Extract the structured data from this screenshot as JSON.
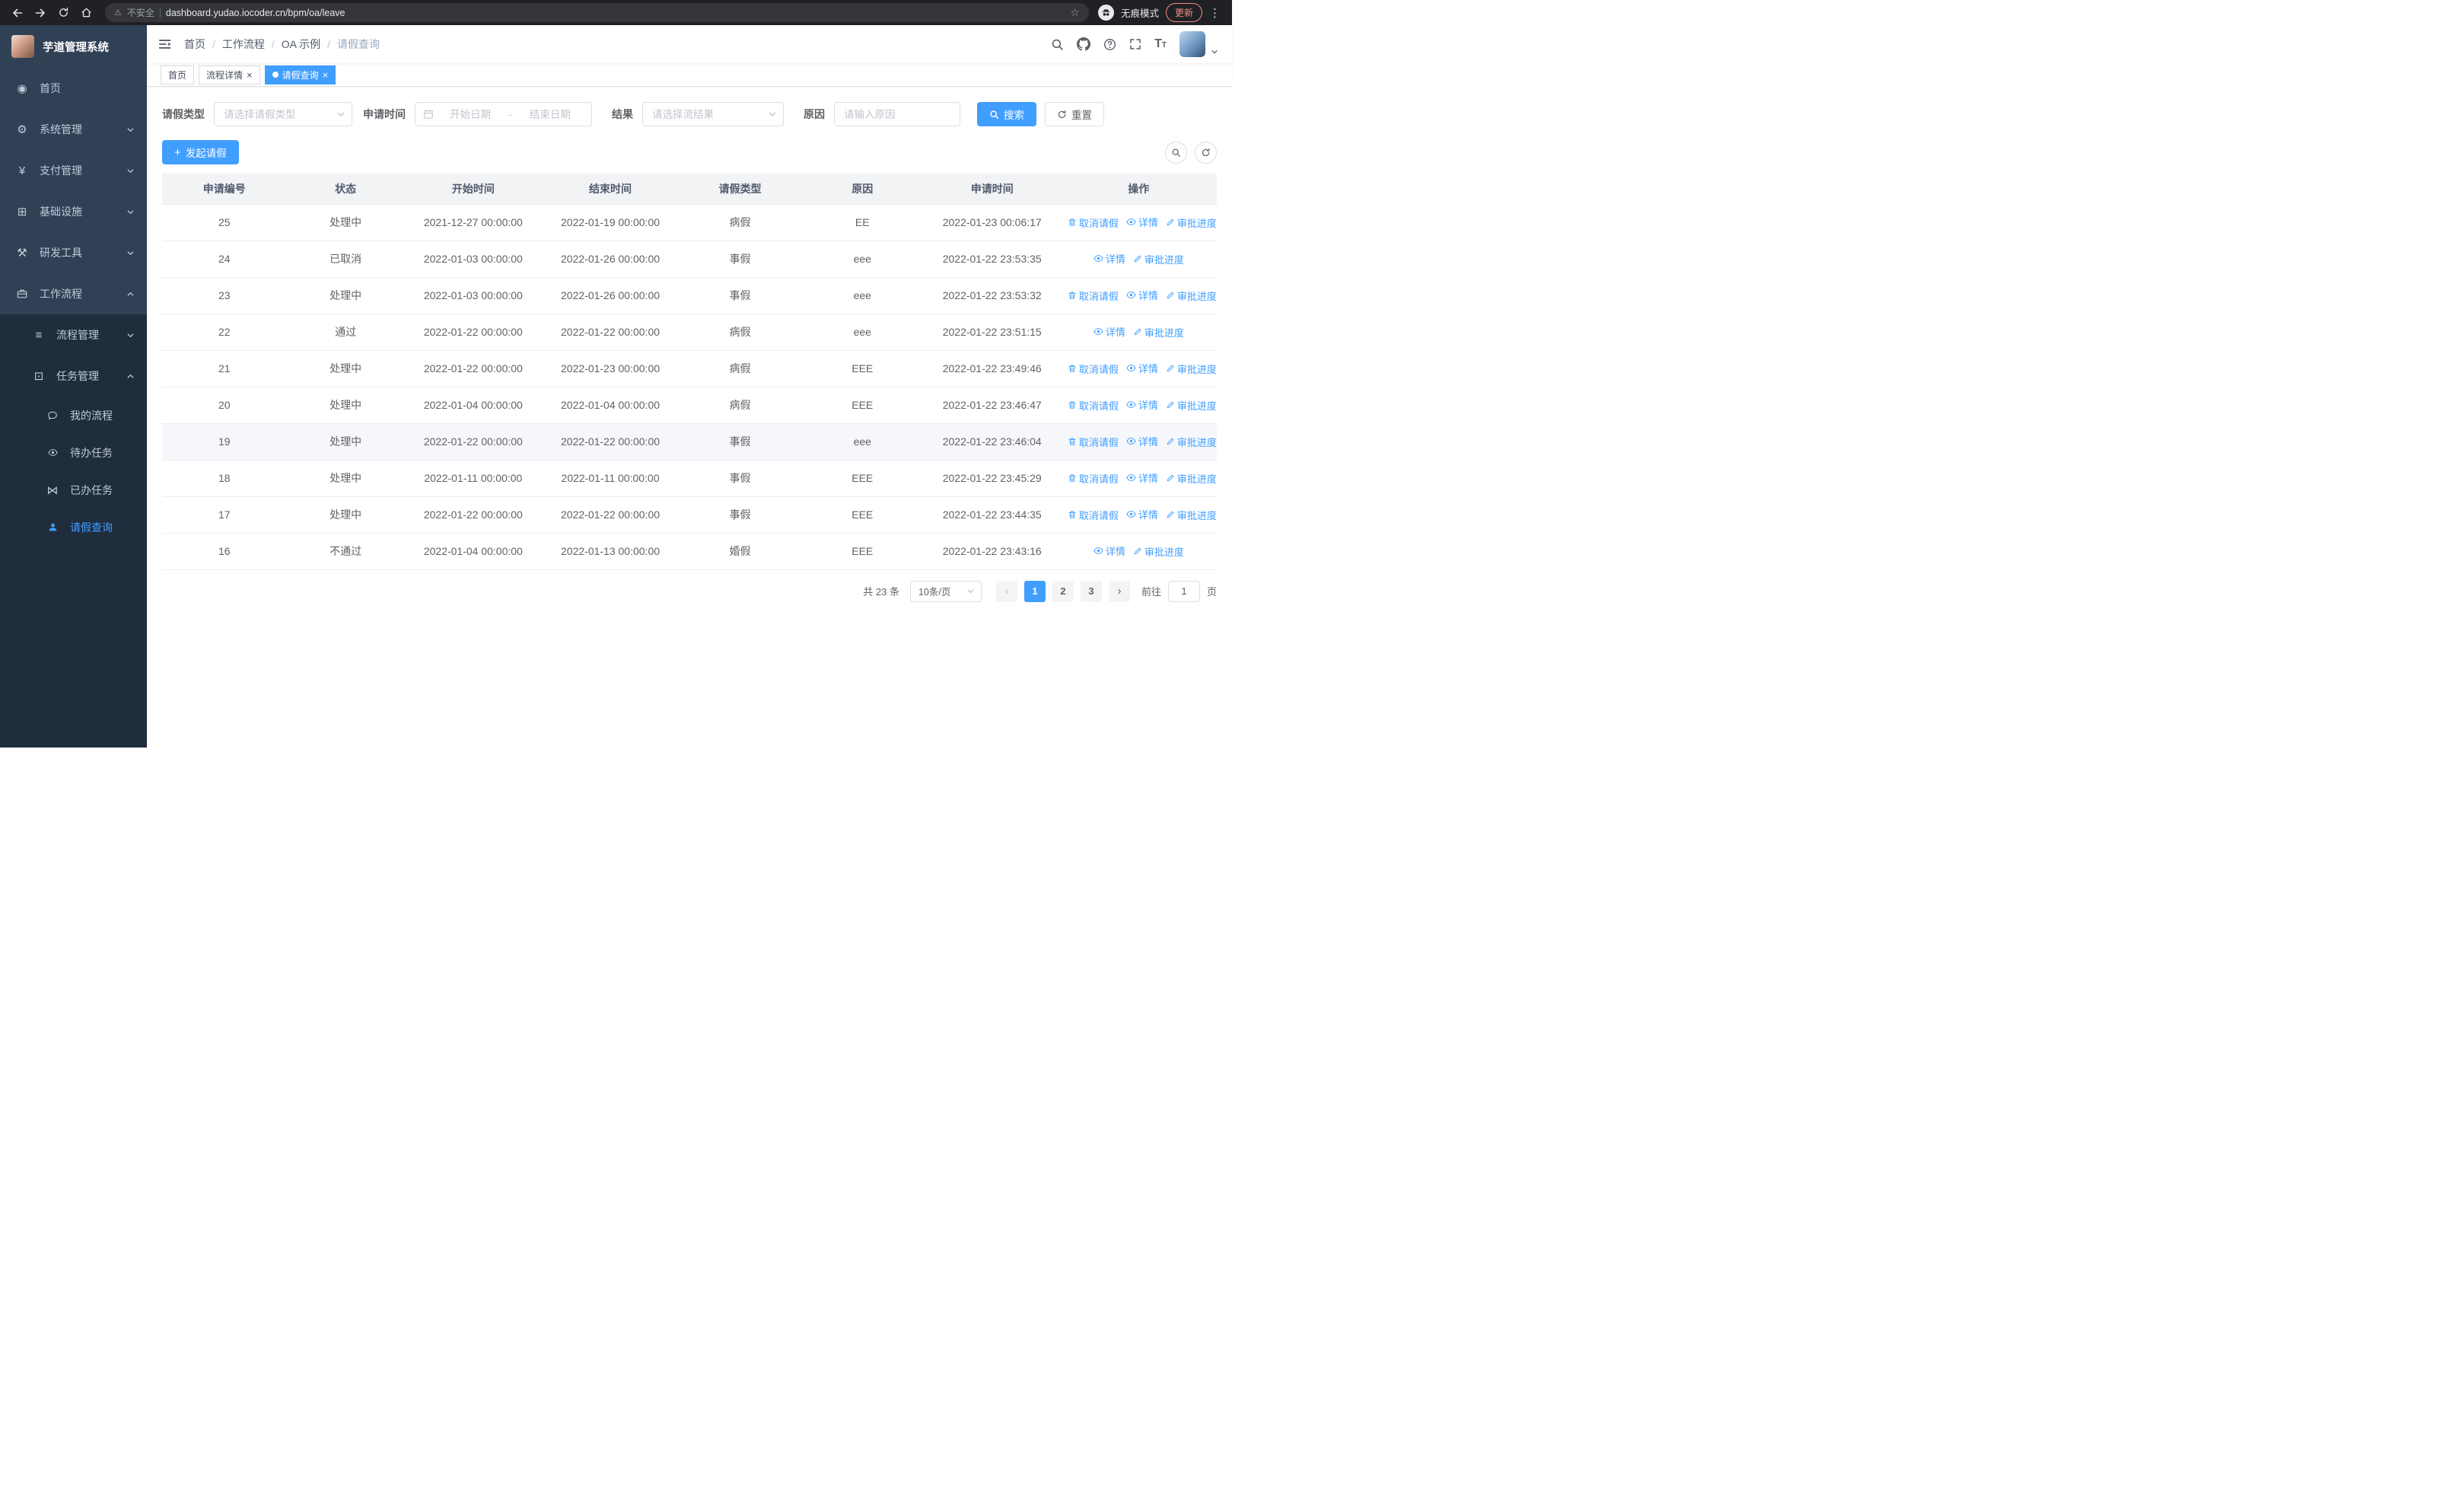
{
  "browser": {
    "security_label": "不安全",
    "url": "dashboard.yudao.iocoder.cn/bpm/oa/leave",
    "incognito_label": "无痕模式",
    "update_label": "更新"
  },
  "sidebar": {
    "title": "芋道管理系统",
    "items": [
      {
        "key": "home",
        "label": "首页",
        "icon": "dashboard-icon",
        "level": 1
      },
      {
        "key": "system",
        "label": "系统管理",
        "icon": "gear-icon",
        "level": 1,
        "chevron": "down"
      },
      {
        "key": "payment",
        "label": "支付管理",
        "icon": "yen-icon",
        "level": 1,
        "chevron": "down"
      },
      {
        "key": "infra",
        "label": "基础设施",
        "icon": "monitor-icon",
        "level": 1,
        "chevron": "down"
      },
      {
        "key": "devtools",
        "label": "研发工具",
        "icon": "tools-icon",
        "level": 1,
        "chevron": "down"
      },
      {
        "key": "workflow",
        "label": "工作流程",
        "icon": "briefcase-icon",
        "level": 1,
        "chevron": "up",
        "expanded": true
      },
      {
        "key": "process-mgmt",
        "label": "流程管理",
        "icon": "list-icon",
        "level": 2,
        "chevron": "down"
      },
      {
        "key": "task-mgmt",
        "label": "任务管理",
        "icon": "tasks-icon",
        "level": 2,
        "chevron": "up",
        "expanded": true
      },
      {
        "key": "my-process",
        "label": "我的流程",
        "icon": "message-icon",
        "level": 3
      },
      {
        "key": "todo-task",
        "label": "待办任务",
        "icon": "eye-icon",
        "level": 3
      },
      {
        "key": "done-task",
        "label": "已办任务",
        "icon": "done-icon",
        "level": 3
      },
      {
        "key": "leave-query",
        "label": "请假查询",
        "icon": "user-icon",
        "level": 3,
        "active": true
      }
    ]
  },
  "header": {
    "breadcrumb": [
      "首页",
      "工作流程",
      "OA 示例",
      "请假查询"
    ]
  },
  "tabs": [
    {
      "key": "home",
      "label": "首页",
      "active": false,
      "closable": false
    },
    {
      "key": "process-detail",
      "label": "流程详情",
      "active": false,
      "closable": true
    },
    {
      "key": "leave-query",
      "label": "请假查询",
      "active": true,
      "closable": true
    }
  ],
  "filters": {
    "leave_type_label": "请假类型",
    "leave_type_placeholder": "请选择请假类型",
    "apply_time_label": "申请时间",
    "start_date_placeholder": "开始日期",
    "range_separator": "-",
    "end_date_placeholder": "结束日期",
    "result_label": "结果",
    "result_placeholder": "请选择流结果",
    "reason_label": "原因",
    "reason_placeholder": "请输入原因",
    "search_label": "搜索",
    "reset_label": "重置"
  },
  "toolbar": {
    "create_label": "发起请假"
  },
  "table": {
    "columns": [
      "申请编号",
      "状态",
      "开始时间",
      "结束时间",
      "请假类型",
      "原因",
      "申请时间",
      "操作"
    ],
    "column_keys": [
      "application-id",
      "status",
      "start-time",
      "end-time",
      "leave-type",
      "reason",
      "apply-time",
      "operations"
    ],
    "ops_labels": {
      "cancel": "取消请假",
      "detail": "详情",
      "progress": "审批进度"
    },
    "rows": [
      {
        "id": "25",
        "status": "处理中",
        "start": "2021-12-27 00:00:00",
        "end": "2022-01-19 00:00:00",
        "type": "病假",
        "reason": "EE",
        "applied": "2022-01-23 00:06:17",
        "ops": [
          "cancel",
          "detail",
          "progress"
        ],
        "highlight": false
      },
      {
        "id": "24",
        "status": "已取消",
        "start": "2022-01-03 00:00:00",
        "end": "2022-01-26 00:00:00",
        "type": "事假",
        "reason": "eee",
        "applied": "2022-01-22 23:53:35",
        "ops": [
          "detail",
          "progress"
        ],
        "highlight": false
      },
      {
        "id": "23",
        "status": "处理中",
        "start": "2022-01-03 00:00:00",
        "end": "2022-01-26 00:00:00",
        "type": "事假",
        "reason": "eee",
        "applied": "2022-01-22 23:53:32",
        "ops": [
          "cancel",
          "detail",
          "progress"
        ],
        "highlight": false
      },
      {
        "id": "22",
        "status": "通过",
        "start": "2022-01-22 00:00:00",
        "end": "2022-01-22 00:00:00",
        "type": "病假",
        "reason": "eee",
        "applied": "2022-01-22 23:51:15",
        "ops": [
          "detail",
          "progress"
        ],
        "highlight": false
      },
      {
        "id": "21",
        "status": "处理中",
        "start": "2022-01-22 00:00:00",
        "end": "2022-01-23 00:00:00",
        "type": "病假",
        "reason": "EEE",
        "applied": "2022-01-22 23:49:46",
        "ops": [
          "cancel",
          "detail",
          "progress"
        ],
        "highlight": false
      },
      {
        "id": "20",
        "status": "处理中",
        "start": "2022-01-04 00:00:00",
        "end": "2022-01-04 00:00:00",
        "type": "病假",
        "reason": "EEE",
        "applied": "2022-01-22 23:46:47",
        "ops": [
          "cancel",
          "detail",
          "progress"
        ],
        "highlight": false
      },
      {
        "id": "19",
        "status": "处理中",
        "start": "2022-01-22 00:00:00",
        "end": "2022-01-22 00:00:00",
        "type": "事假",
        "reason": "eee",
        "applied": "2022-01-22 23:46:04",
        "ops": [
          "cancel",
          "detail",
          "progress"
        ],
        "highlight": true
      },
      {
        "id": "18",
        "status": "处理中",
        "start": "2022-01-11 00:00:00",
        "end": "2022-01-11 00:00:00",
        "type": "事假",
        "reason": "EEE",
        "applied": "2022-01-22 23:45:29",
        "ops": [
          "cancel",
          "detail",
          "progress"
        ],
        "highlight": false
      },
      {
        "id": "17",
        "status": "处理中",
        "start": "2022-01-22 00:00:00",
        "end": "2022-01-22 00:00:00",
        "type": "事假",
        "reason": "EEE",
        "applied": "2022-01-22 23:44:35",
        "ops": [
          "cancel",
          "detail",
          "progress"
        ],
        "highlight": false
      },
      {
        "id": "16",
        "status": "不通过",
        "start": "2022-01-04 00:00:00",
        "end": "2022-01-13 00:00:00",
        "type": "婚假",
        "reason": "EEE",
        "applied": "2022-01-22 23:43:16",
        "ops": [
          "detail",
          "progress"
        ],
        "highlight": false
      }
    ]
  },
  "pagination": {
    "total_label": "共 23 条",
    "page_size": "10条/页",
    "pages": [
      "1",
      "2",
      "3"
    ],
    "active_page": "1",
    "goto_label": "前往",
    "goto_value": "1",
    "page_label": "页"
  },
  "colors": {
    "primary": "#409eff",
    "sidebar_bg": "#304156",
    "sidebar_submenu_bg": "#1f2d3d",
    "update_pill": "#f28b82"
  }
}
